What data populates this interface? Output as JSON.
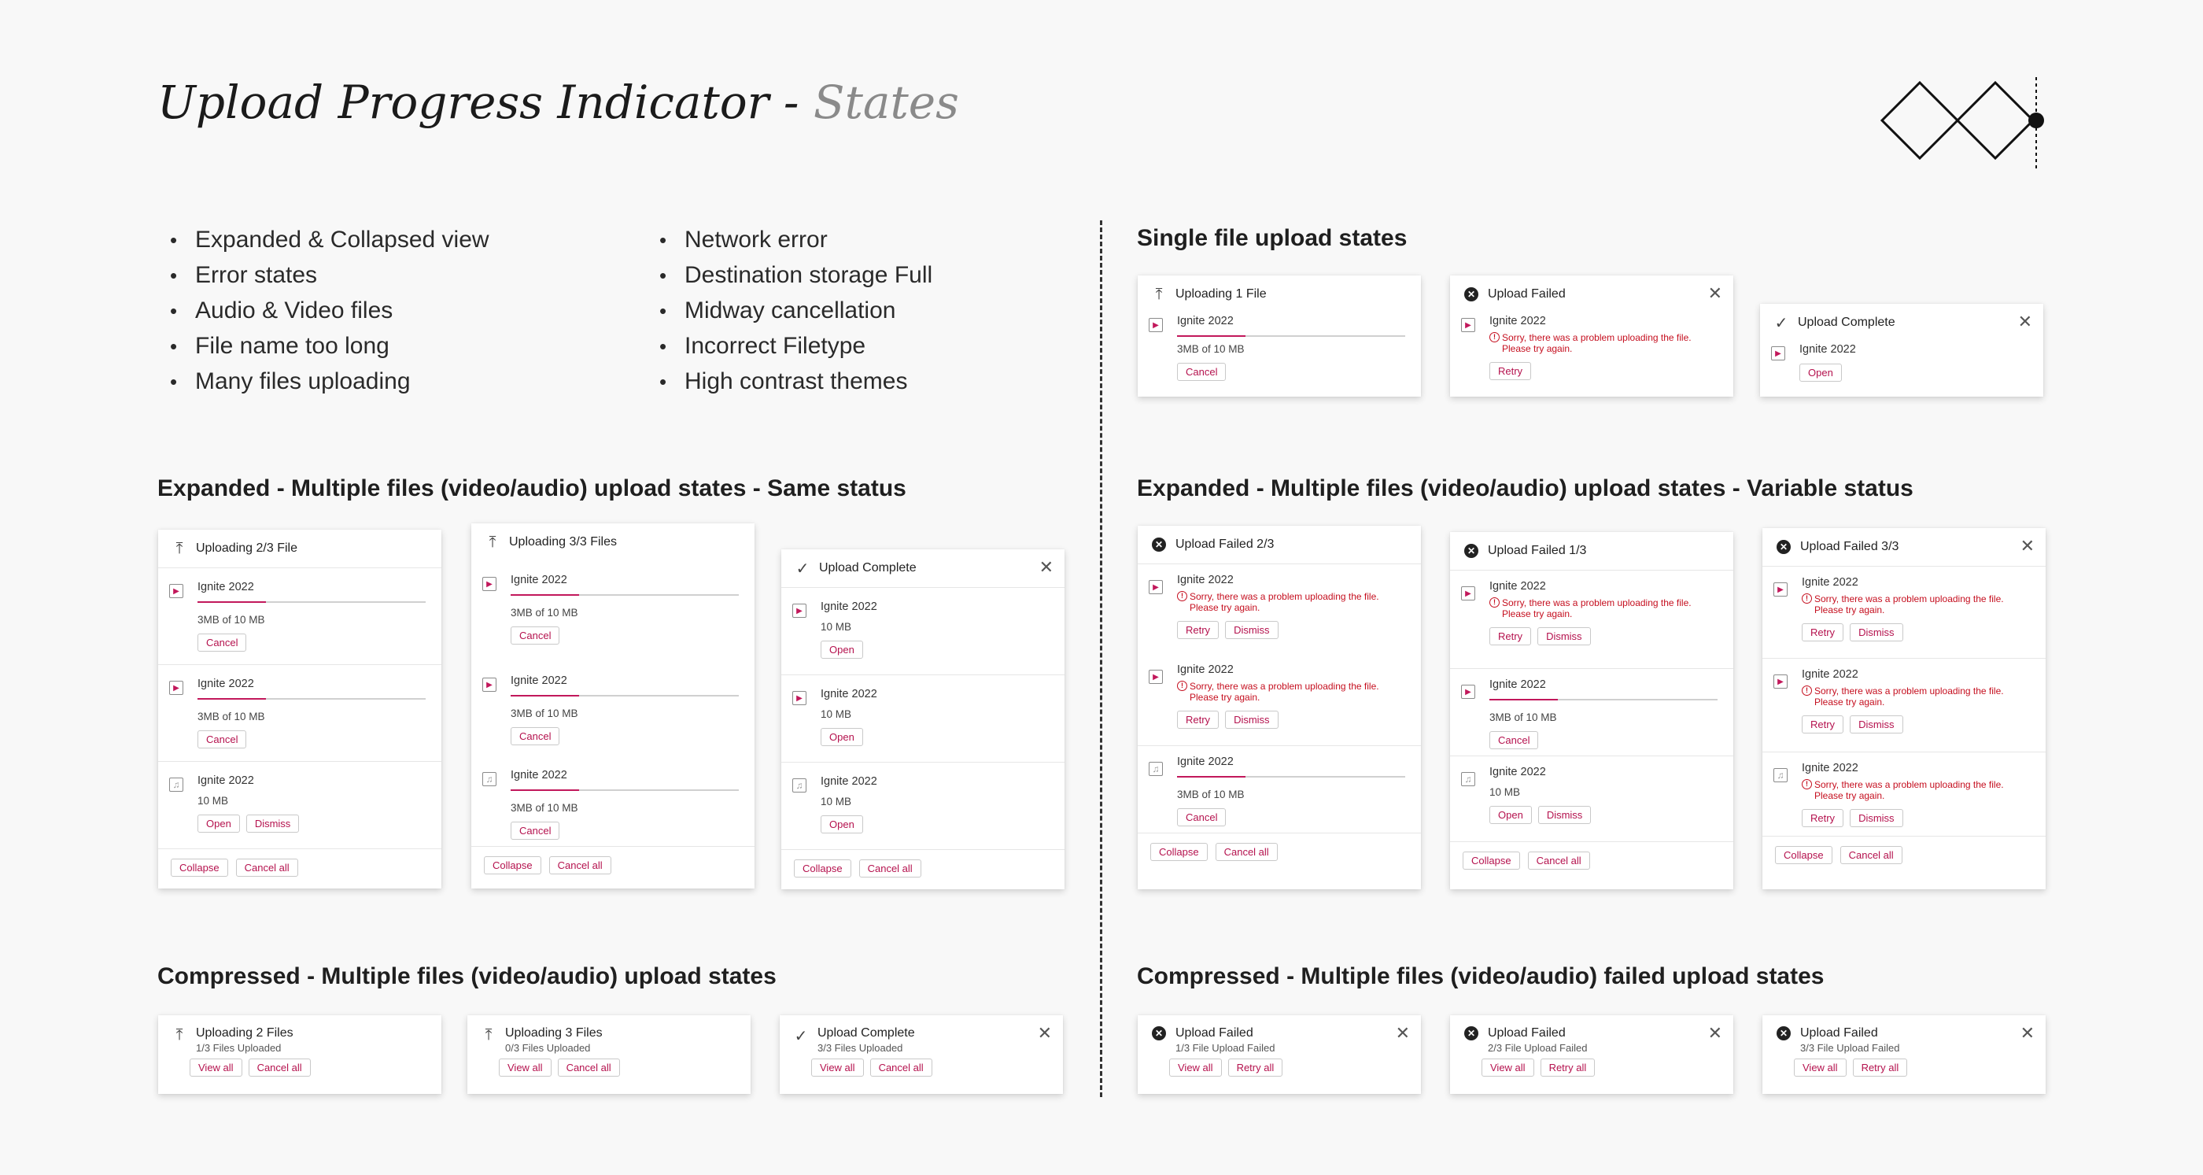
{
  "title": {
    "main": "Upload Progress Indicator -",
    "sub": "States"
  },
  "bullets_left": [
    "Expanded & Collapsed view",
    "Error states",
    "Audio & Video files",
    "File name too long",
    "Many files uploading"
  ],
  "bullets_right": [
    "Network error",
    "Destination storage Full",
    "Midway cancellation",
    "Incorrect Filetype",
    "High contrast themes"
  ],
  "sections": {
    "single": "Single file upload states",
    "expanded_same": "Expanded - Multiple files (video/audio) upload states - Same status",
    "expanded_variable": "Expanded - Multiple files (video/audio) upload states - Variable status",
    "compressed": "Compressed - Multiple files (video/audio) upload states",
    "compressed_failed": "Compressed - Multiple files (video/audio) failed upload states"
  },
  "common": {
    "file_name": "Ignite 2022",
    "size_progress": "3MB of 10 MB",
    "size_full": "10 MB",
    "error_msg_1": "Sorry, there was a problem uploading the file.",
    "error_msg_2": "Please try again.",
    "cancel": "Cancel",
    "open": "Open",
    "dismiss": "Dismiss",
    "retry": "Retry",
    "collapse": "Collapse",
    "cancel_all": "Cancel all",
    "view_all": "View all",
    "retry_all": "Retry all"
  },
  "single_cards": [
    {
      "title": "Uploading 1 File",
      "icon": "upload-icon",
      "progress": 0.3
    },
    {
      "title": "Upload Failed",
      "icon": "failed-icon"
    },
    {
      "title": "Upload Complete",
      "icon": "check-icon"
    }
  ],
  "expanded_same_cards": [
    {
      "title": "Uploading 2/3 File",
      "icon": "upload-icon"
    },
    {
      "title": "Uploading 3/3 Files",
      "icon": "upload-icon"
    },
    {
      "title": "Upload Complete",
      "icon": "check-icon"
    }
  ],
  "expanded_variable_cards": [
    {
      "title": "Upload Failed 2/3",
      "icon": "failed-icon"
    },
    {
      "title": "Upload Failed 1/3",
      "icon": "failed-icon"
    },
    {
      "title": "Upload Failed 3/3",
      "icon": "failed-icon"
    }
  ],
  "compressed_cards": [
    {
      "title": "Uploading 2 Files",
      "meta": "1/3 Files  Uploaded",
      "icon": "upload-icon"
    },
    {
      "title": "Uploading 3 Files",
      "meta": "0/3 Files  Uploaded",
      "icon": "upload-icon"
    },
    {
      "title": "Upload Complete",
      "meta": "3/3 Files  Uploaded",
      "icon": "check-icon"
    }
  ],
  "compressed_failed_cards": [
    {
      "title": "Upload Failed",
      "meta": "1/3 File  Upload Failed",
      "icon": "failed-icon"
    },
    {
      "title": "Upload Failed",
      "meta": "2/3 File  Upload Failed",
      "icon": "failed-icon"
    },
    {
      "title": "Upload Failed",
      "meta": "3/3 File  Upload Failed",
      "icon": "failed-icon"
    }
  ],
  "colors": {
    "accent": "#c2185b",
    "error": "#c50f1f"
  }
}
